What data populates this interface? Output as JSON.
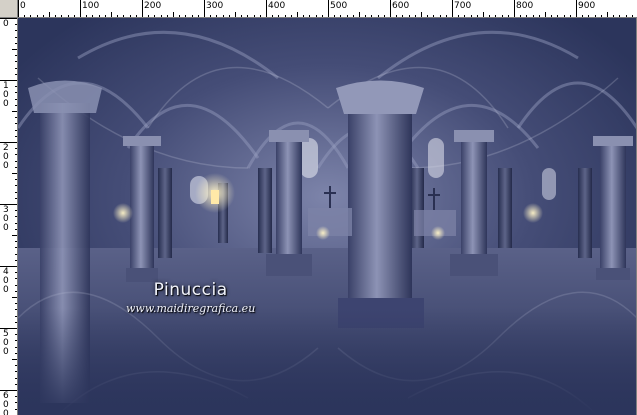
{
  "rulers": {
    "horizontal_labels": [
      "0",
      "100",
      "200",
      "300",
      "400",
      "500",
      "600",
      "700",
      "800",
      "900"
    ],
    "vertical_labels": [
      "0",
      "100",
      "200",
      "300",
      "400",
      "500",
      "600"
    ]
  },
  "image": {
    "watermark_name": "Pinuccia",
    "watermark_url": "www.maidiregrafica.eu",
    "colors": {
      "tint": "#2c355c",
      "stone_light": "#9aa0c0",
      "stone_dark": "#1c2240",
      "candle": "#ffe9a8"
    }
  }
}
